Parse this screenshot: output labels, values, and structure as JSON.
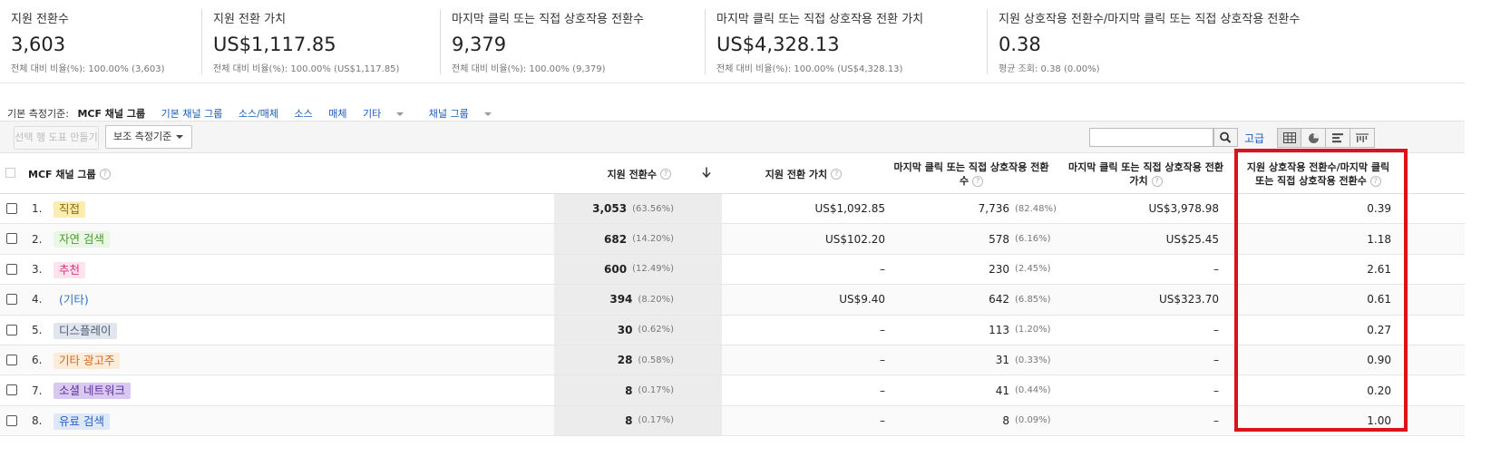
{
  "scorecard": [
    {
      "label": "지원 전환수",
      "value": "3,603",
      "sub": "전체 대비 비율(%): 100.00% (3,603)"
    },
    {
      "label": "지원 전환 가치",
      "value": "US$1,117.85",
      "sub": "전체 대비 비율(%): 100.00% (US$1,117.85)"
    },
    {
      "label": "마지막 클릭 또는 직접 상호작용 전환수",
      "value": "9,379",
      "sub": "전체 대비 비율(%): 100.00% (9,379)"
    },
    {
      "label": "마지막 클릭 또는 직접 상호작용 전환 가치",
      "value": "US$4,328.13",
      "sub": "전체 대비 비율(%): 100.00% (US$4,328.13)"
    },
    {
      "label": "지원 상호작용 전환수/마지막 클릭 또는 직접 상호작용 전환수",
      "value": "0.38",
      "sub": "평균 조회: 0.38 (0.00%)"
    }
  ],
  "dimension_bar": {
    "label": "기본 측정기준:",
    "active": "MCF 채널 그룹",
    "links": [
      "기본 채널 그룹",
      "소스/매체",
      "소스",
      "매체"
    ],
    "other": "기타",
    "channel_group": "채널 그룹"
  },
  "toolbar": {
    "plot_rows": "선택 행 도표 만들기",
    "secondary_dimension": "보조 측정기준",
    "search_placeholder": "",
    "advanced": "고급"
  },
  "table": {
    "headers": {
      "dimension": "MCF 채널 그룹",
      "assisted_conversions": "지원 전환수",
      "assisted_value": "지원 전환 가치",
      "last_click_conversions_1": "마지막 클릭 또는 직접 상호작용 전환",
      "last_click_conversions_2": "수",
      "last_click_value_1": "마지막 클릭 또는 직접 상호작용 전환",
      "last_click_value_2": "가치",
      "ratio_1": "지원 상호작용 전환수/마지막 클릭",
      "ratio_2": "또는 직접 상호작용 전환수",
      "help": "?"
    },
    "rows": [
      {
        "idx": "1.",
        "channel": "직접",
        "bg": "#fbecb0",
        "fg": "#8a6d00",
        "assisted": "3,053",
        "assisted_pct": "(63.56%)",
        "assisted_value": "US$1,092.85",
        "last_click": "7,736",
        "last_click_pct": "(82.48%)",
        "last_value": "US$3,978.98",
        "ratio": "0.39"
      },
      {
        "idx": "2.",
        "channel": "자연 검색",
        "bg": "#eaf7e4",
        "fg": "#4b9a2e",
        "assisted": "682",
        "assisted_pct": "(14.20%)",
        "assisted_value": "US$102.20",
        "last_click": "578",
        "last_click_pct": "(6.16%)",
        "last_value": "US$25.45",
        "ratio": "1.18"
      },
      {
        "idx": "3.",
        "channel": "추천",
        "bg": "#fde3ee",
        "fg": "#d4357a",
        "assisted": "600",
        "assisted_pct": "(12.49%)",
        "assisted_value": "–",
        "last_click": "230",
        "last_click_pct": "(2.45%)",
        "last_value": "–",
        "ratio": "2.61"
      },
      {
        "idx": "4.",
        "channel": "(기타)",
        "bg": "transparent",
        "fg": "#2c6fbe",
        "assisted": "394",
        "assisted_pct": "(8.20%)",
        "assisted_value": "US$9.40",
        "last_click": "642",
        "last_click_pct": "(6.85%)",
        "last_value": "US$323.70",
        "ratio": "0.61"
      },
      {
        "idx": "5.",
        "channel": "디스플레이",
        "bg": "#e1e6ee",
        "fg": "#4a5b74",
        "assisted": "30",
        "assisted_pct": "(0.62%)",
        "assisted_value": "–",
        "last_click": "113",
        "last_click_pct": "(1.20%)",
        "last_value": "–",
        "ratio": "0.27"
      },
      {
        "idx": "6.",
        "channel": "기타 광고주",
        "bg": "#fdecd9",
        "fg": "#d2691e",
        "assisted": "28",
        "assisted_pct": "(0.58%)",
        "assisted_value": "–",
        "last_click": "31",
        "last_click_pct": "(0.33%)",
        "last_value": "–",
        "ratio": "0.90"
      },
      {
        "idx": "7.",
        "channel": "소셜 네트워크",
        "bg": "#d9c9f1",
        "fg": "#5a2f98",
        "assisted": "8",
        "assisted_pct": "(0.17%)",
        "assisted_value": "–",
        "last_click": "41",
        "last_click_pct": "(0.44%)",
        "last_value": "–",
        "ratio": "0.20"
      },
      {
        "idx": "8.",
        "channel": "유료 검색",
        "bg": "#dde9fb",
        "fg": "#2c63b8",
        "assisted": "8",
        "assisted_pct": "(0.17%)",
        "assisted_value": "–",
        "last_click": "8",
        "last_click_pct": "(0.09%)",
        "last_value": "–",
        "ratio": "1.00"
      }
    ]
  },
  "colors": {
    "highlight": "#d9121c",
    "link": "#1a5dbb"
  }
}
